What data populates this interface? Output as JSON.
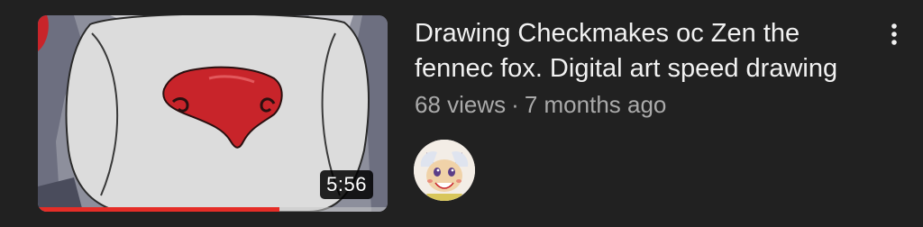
{
  "video": {
    "title": "Drawing Checkmakes oc Zen the fennec fox. Digital art speed drawing",
    "views": "68 views",
    "separator": "·",
    "age": "7 months ago",
    "duration": "5:56",
    "watched_fraction": 0.69
  },
  "icons": {
    "menu": "more-vert-icon",
    "channel": "channel-avatar"
  },
  "colors": {
    "background": "#212121",
    "title": "#f1f1f1",
    "meta": "#aaaaaa",
    "progress": "#e52d27",
    "nose": "#c8242a"
  }
}
